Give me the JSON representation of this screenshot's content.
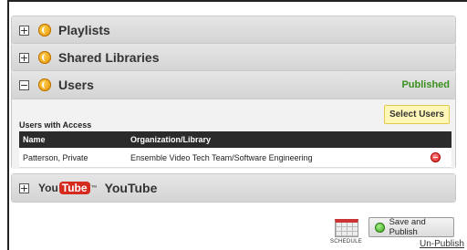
{
  "sections": {
    "playlists": {
      "toggle": "+",
      "title": "Playlists"
    },
    "shared": {
      "toggle": "+",
      "title": "Shared Libraries"
    },
    "users": {
      "toggle": "−",
      "title": "Users",
      "status": "Published"
    },
    "youtube": {
      "toggle": "+",
      "logo_you": "You",
      "logo_tube": "Tube",
      "logo_tm": "™",
      "title": "YouTube"
    }
  },
  "users_panel": {
    "select_button": "Select Users",
    "access_label": "Users with Access",
    "columns": [
      "Name",
      "Organization/Library"
    ],
    "rows": [
      {
        "name": "Patterson, Private",
        "org": "Ensemble Video Tech Team/Software Engineering"
      }
    ]
  },
  "footer": {
    "schedule_label": "SCHEDULE",
    "save_publish": "Save and Publish",
    "unpublish": "Un-Publish"
  },
  "colors": {
    "published": "#3a8f1e",
    "select_users_bg": "#fff7b8",
    "header_dark": "#2b2b2b"
  }
}
